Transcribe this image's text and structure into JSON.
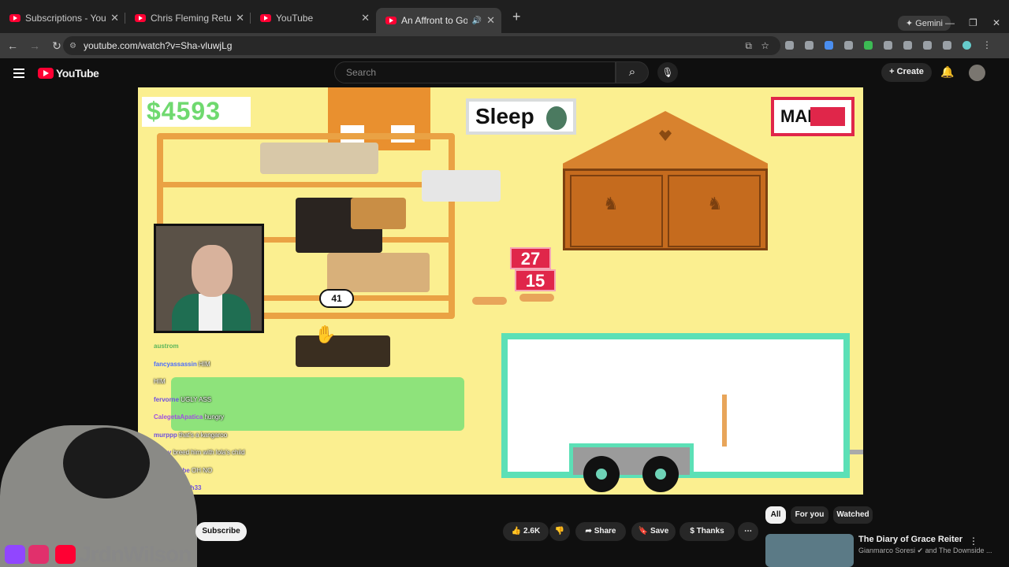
{
  "browser": {
    "tabs": [
      {
        "title": "Subscriptions - YouTube"
      },
      {
        "title": "Chris Fleming Returns Again - Y"
      },
      {
        "title": "YouTube"
      },
      {
        "title": "An Affront to God - YouTub"
      }
    ],
    "new_tab": "+",
    "gemini": "Gemini",
    "url": "youtube.com/watch?v=Sha-vluwjLg"
  },
  "youtube": {
    "logo_text": "YouTube",
    "search_placeholder": "Search",
    "create_label": "Create"
  },
  "game": {
    "money": "$4593",
    "sleep_label": "Sleep",
    "map_label": "MAP",
    "badge_top": "27",
    "badge_bottom": "15",
    "bubble": "41",
    "chat": [
      {
        "user": "austrom",
        "msg": ""
      },
      {
        "user": "fancyassassin",
        "msg": "HIM"
      },
      {
        "user": "",
        "msg": "HIM"
      },
      {
        "user": "fervorne",
        "msg": "UGLY ASS"
      },
      {
        "user": "CalegetaApatica",
        "msg": "hungry"
      },
      {
        "user": "murppp",
        "msg": "that's a kangaroo"
      },
      {
        "user": "Yitrov",
        "msg": "breed him with lola's child"
      },
      {
        "user": "u_watanabe",
        "msg": "OH NO"
      },
      {
        "user": "lets_get_high33",
        "msg": ""
      }
    ]
  },
  "watch": {
    "subscribe_label": "Subscribe",
    "like_count": "2.6K",
    "share_label": "Share",
    "save_label": "Save",
    "thanks_label": "Thanks",
    "overlay_name": "JrdnWilson"
  },
  "sidebar": {
    "chips": [
      "All",
      "For you",
      "Watched"
    ],
    "rec_title": "The Diary of Grace Reiter",
    "rec_channel": "Gianmarco Soresi",
    "rec_channel_extra": "and The Downside ..."
  },
  "colors": {
    "accent": "#ff0033",
    "game_bg": "#fbef90",
    "money_green": "#6fd96f",
    "map_red": "#e0264a",
    "trailer_teal": "#5ce0b6"
  }
}
